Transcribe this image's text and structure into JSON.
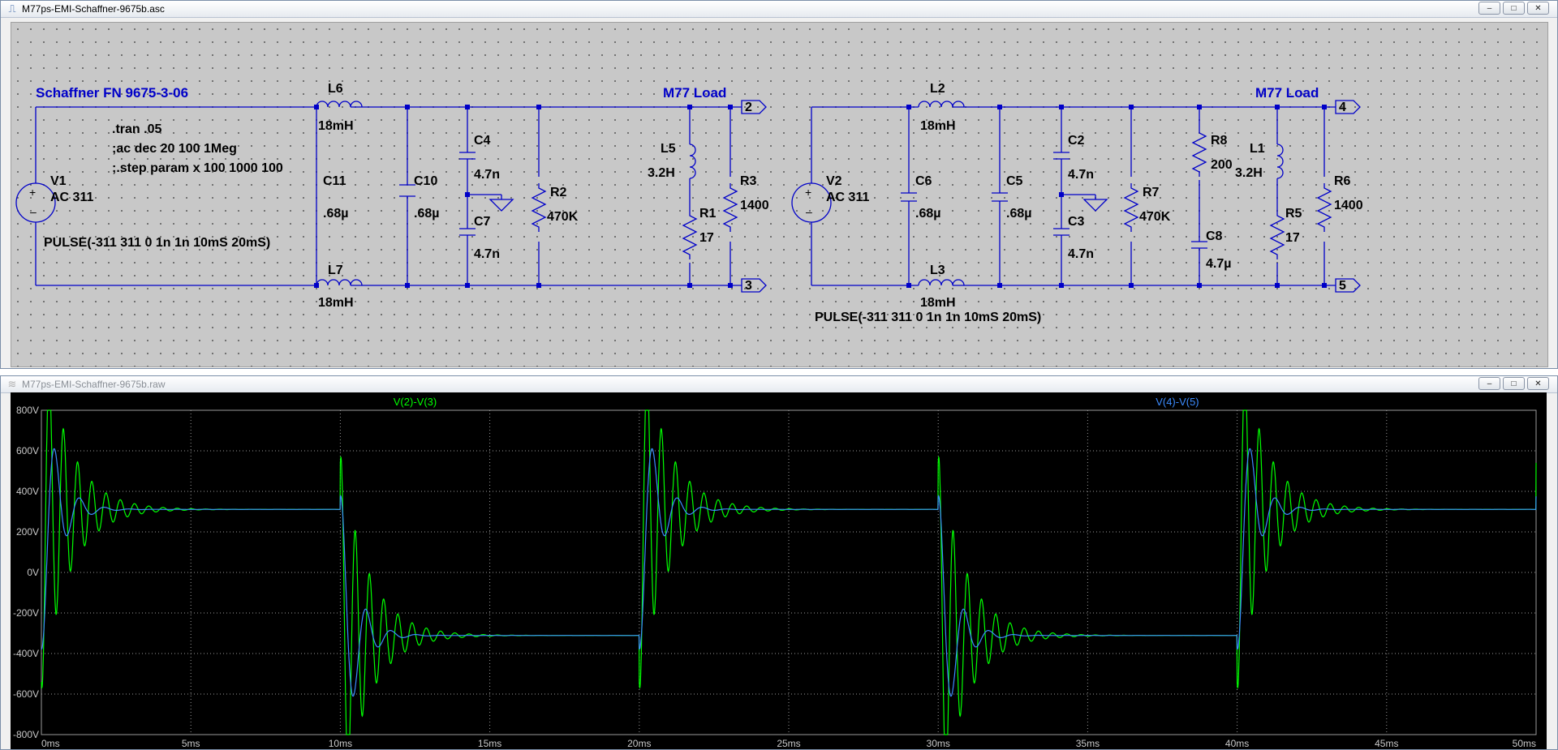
{
  "schematic_window": {
    "title": "M77ps-EMI-Schaffner-9675b.asc",
    "buttons": [
      "–",
      "□",
      "✕"
    ]
  },
  "schematic": {
    "left_label": "Schaffner FN 9675-3-06",
    "load_label_1": "M77 Load",
    "load_label_2": "M77 Load",
    "directives": [
      ".tran .05",
      ";ac dec 20 100 1Meg",
      ";.step param x 100 1000 100"
    ],
    "pulse_left": "PULSE(-311 311 0 1n 1n 10mS 20mS)",
    "pulse_right": "PULSE(-311 311 0 1n 1n 10mS 20mS)",
    "ports": [
      "2",
      "3",
      "4",
      "5"
    ],
    "components": {
      "V1": {
        "name": "V1",
        "value": "AC 311"
      },
      "V2": {
        "name": "V2",
        "value": "AC 311"
      },
      "L6": {
        "name": "L6",
        "value": "18mH"
      },
      "L7": {
        "name": "L7",
        "value": "18mH"
      },
      "L2": {
        "name": "L2",
        "value": "18mH"
      },
      "L3": {
        "name": "L3",
        "value": "18mH"
      },
      "C11": {
        "name": "C11",
        "value": ".68µ"
      },
      "C10": {
        "name": "C10",
        "value": ".68µ"
      },
      "C6": {
        "name": "C6",
        "value": ".68µ"
      },
      "C5": {
        "name": "C5",
        "value": ".68µ"
      },
      "C4": {
        "name": "C4",
        "value": "4.7n"
      },
      "C7": {
        "name": "C7",
        "value": "4.7n"
      },
      "C2": {
        "name": "C2",
        "value": "4.7n"
      },
      "C3": {
        "name": "C3",
        "value": "4.7n"
      },
      "C8": {
        "name": "C8",
        "value": "4.7µ"
      },
      "R2": {
        "name": "R2",
        "value": "470K"
      },
      "R7": {
        "name": "R7",
        "value": "470K"
      },
      "L5": {
        "name": "L5",
        "value": "3.2H"
      },
      "L1": {
        "name": "L1",
        "value": "3.2H"
      },
      "R1": {
        "name": "R1",
        "value": "17"
      },
      "R5": {
        "name": "R5",
        "value": "17"
      },
      "R3": {
        "name": "R3",
        "value": "1400"
      },
      "R6": {
        "name": "R6",
        "value": "1400"
      },
      "R8": {
        "name": "R8",
        "value": "200"
      }
    }
  },
  "plot_window": {
    "title": "M77ps-EMI-Schaffner-9675b.raw",
    "buttons": [
      "–",
      "□",
      "✕"
    ]
  },
  "chart_data": {
    "type": "line",
    "x_unit": "ms",
    "xlim": [
      0,
      50
    ],
    "ylim": [
      -800,
      800
    ],
    "x_ticks": [
      "0ms",
      "5ms",
      "10ms",
      "15ms",
      "20ms",
      "25ms",
      "30ms",
      "35ms",
      "40ms",
      "45ms",
      "50ms"
    ],
    "y_ticks": [
      "800V",
      "600V",
      "400V",
      "200V",
      "0V",
      "-200V",
      "-400V",
      "-600V",
      "-800V"
    ],
    "grid": true,
    "series": [
      {
        "name": "V(2)-V(3)",
        "color": "#00ff00",
        "description_params": {
          "steady": 311,
          "initial_value": -311,
          "period_ms": 20,
          "half_ms": 10,
          "peak": 770,
          "ring_freq_khz": 2.1,
          "decay_ms": 0.9
        }
      },
      {
        "name": "V(4)-V(5)",
        "color": "#3c8cff",
        "description_params": {
          "steady": 311,
          "initial_value": -311,
          "period_ms": 20,
          "half_ms": 10,
          "peak": 440,
          "ring_freq_khz": 1.2,
          "decay_ms": 0.5
        }
      }
    ]
  }
}
